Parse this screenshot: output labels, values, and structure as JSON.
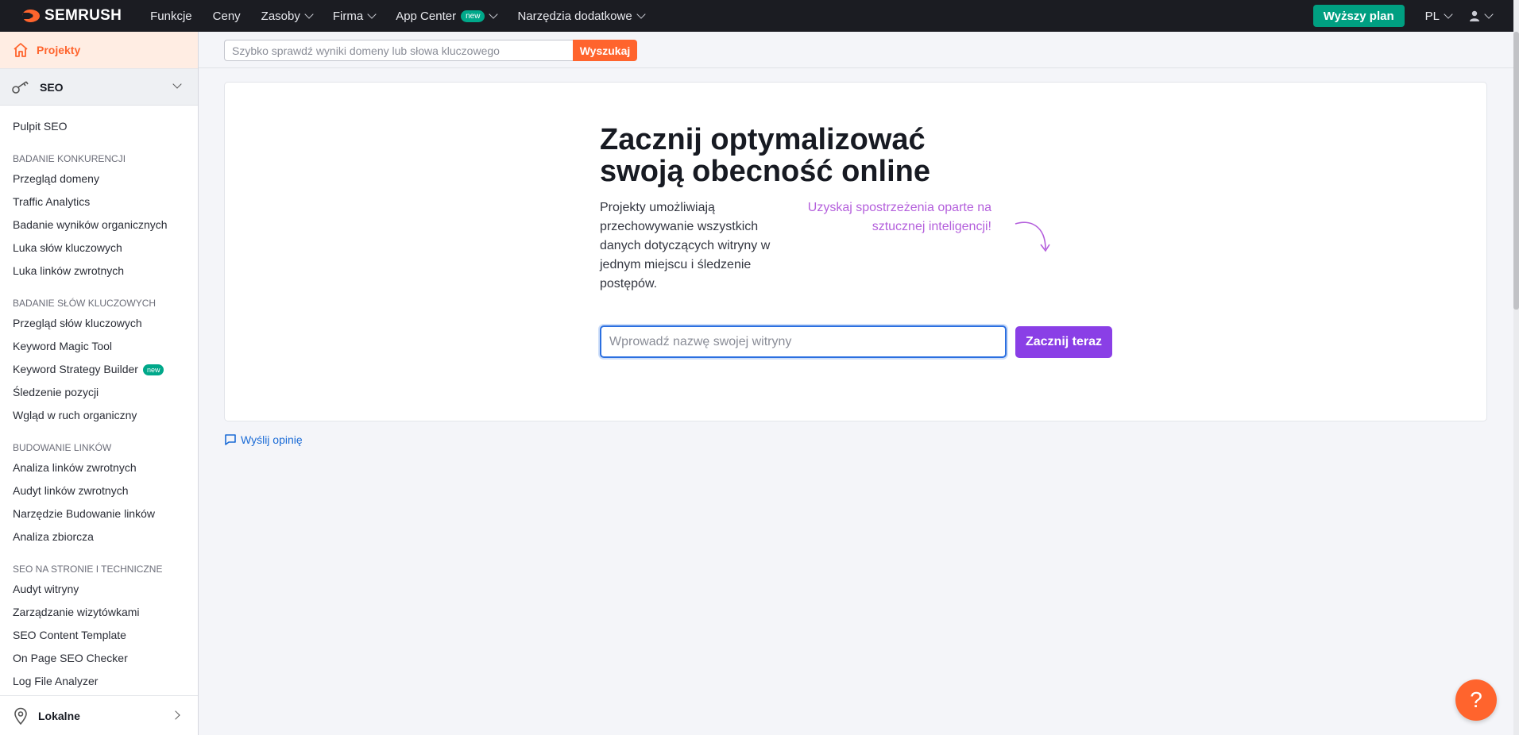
{
  "brand": {
    "name": "SEMRUSH"
  },
  "nav": {
    "items": [
      {
        "label": "Funkcje",
        "dropdown": false
      },
      {
        "label": "Ceny",
        "dropdown": false
      },
      {
        "label": "Zasoby",
        "dropdown": true
      },
      {
        "label": "Firma",
        "dropdown": true
      },
      {
        "label": "App Center",
        "dropdown": true,
        "badge": "new"
      },
      {
        "label": "Narzędzia dodatkowe",
        "dropdown": true
      }
    ],
    "upgrade_label": "Wyższy plan",
    "lang": "PL"
  },
  "sidebar": {
    "projects_label": "Projekty",
    "seo_label": "SEO",
    "items": [
      {
        "type": "item",
        "label": "Pulpit SEO"
      },
      {
        "type": "cat",
        "label": "BADANIE KONKURENCJI"
      },
      {
        "type": "item",
        "label": "Przegląd domeny"
      },
      {
        "type": "item",
        "label": "Traffic Analytics"
      },
      {
        "type": "item",
        "label": "Badanie wyników organicznych"
      },
      {
        "type": "item",
        "label": "Luka słów kluczowych"
      },
      {
        "type": "item",
        "label": "Luka linków zwrotnych"
      },
      {
        "type": "cat",
        "label": "BADANIE SŁÓW KLUCZOWYCH"
      },
      {
        "type": "item",
        "label": "Przegląd słów kluczowych"
      },
      {
        "type": "item",
        "label": "Keyword Magic Tool"
      },
      {
        "type": "item",
        "label": "Keyword Strategy Builder",
        "badge": "new"
      },
      {
        "type": "item",
        "label": "Śledzenie pozycji"
      },
      {
        "type": "item",
        "label": "Wgląd w ruch organiczny"
      },
      {
        "type": "cat",
        "label": "BUDOWANIE LINKÓW"
      },
      {
        "type": "item",
        "label": "Analiza linków zwrotnych"
      },
      {
        "type": "item",
        "label": "Audyt linków zwrotnych"
      },
      {
        "type": "item",
        "label": "Narzędzie Budowanie linków"
      },
      {
        "type": "item",
        "label": "Analiza zbiorcza"
      },
      {
        "type": "cat",
        "label": "SEO NA STRONIE I TECHNICZNE"
      },
      {
        "type": "item",
        "label": "Audyt witryny"
      },
      {
        "type": "item",
        "label": "Zarządzanie wizytówkami"
      },
      {
        "type": "item",
        "label": "SEO Content Template"
      },
      {
        "type": "item",
        "label": "On Page SEO Checker"
      },
      {
        "type": "item",
        "label": "Log File Analyzer"
      }
    ],
    "lokalne_label": "Lokalne"
  },
  "search": {
    "placeholder": "Szybko sprawdź wyniki domeny lub słowa kluczowego",
    "button_label": "Wyszukaj"
  },
  "main": {
    "title": "Zacznij optymalizować swoją obecność online",
    "description": "Projekty umożliwiają przechowywanie wszystkich danych dotyczących witryny w jednym miejscu i śledzenie postępów.",
    "ai_note": "Uzyskaj spostrzeżenia oparte na sztucznej inteligencji!",
    "site_placeholder": "Wprowadź nazwę swojej witryny",
    "start_label": "Zacznij teraz",
    "feedback_label": "Wyślij opinię"
  },
  "help_label": "?",
  "colors": {
    "brand_orange": "#ff642d",
    "upgrade_green": "#009f81",
    "start_purple": "#8a3fe6",
    "ai_text": "#b45fdc",
    "link_blue": "#1a6bd6"
  }
}
